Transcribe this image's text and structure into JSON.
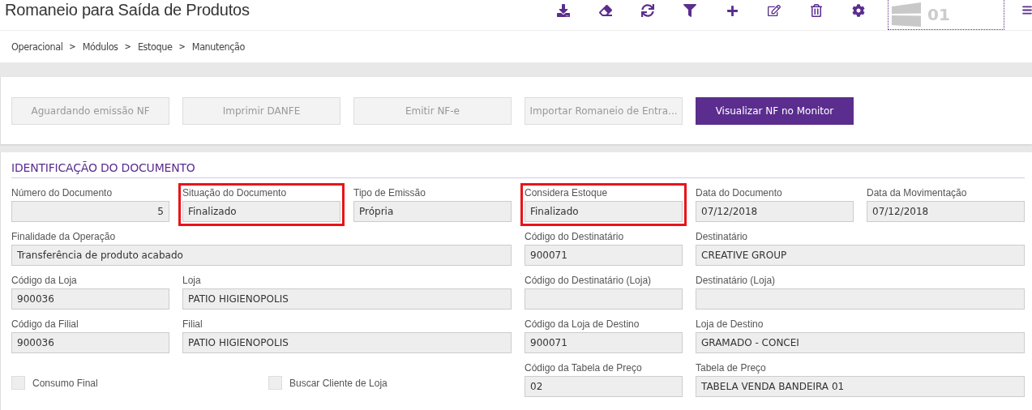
{
  "header": {
    "title": "Romaneio para Saída de Produtos",
    "logo_text": "01"
  },
  "breadcrumb": {
    "separator": ">",
    "items": [
      "Operacional",
      "Módulos",
      "Estoque",
      "Manutenção"
    ]
  },
  "actions": [
    {
      "label": "Aguardando emissão NF",
      "disabled": true
    },
    {
      "label": "Imprimir DANFE",
      "disabled": true
    },
    {
      "label": "Emitir NF-e",
      "disabled": true
    },
    {
      "label": "Importar Romaneio de Entra...",
      "disabled": true
    },
    {
      "label": "Visualizar NF no Monitor",
      "disabled": false
    }
  ],
  "section": {
    "title": "IDENTIFICAÇÃO DO DOCUMENTO",
    "rows": [
      [
        {
          "kind": "field",
          "label": "Número do Documento",
          "value": "5",
          "align_right": true,
          "highlighted": false
        },
        {
          "kind": "field",
          "label": "Situação do Documento",
          "value": "Finalizado",
          "highlighted": true
        },
        {
          "kind": "field",
          "label": "Tipo de Emissão",
          "value": "Própria",
          "highlighted": false
        },
        {
          "kind": "field",
          "label": "Considera Estoque",
          "value": "Finalizado",
          "highlighted": true
        },
        {
          "kind": "field",
          "label": "Data do Documento",
          "value": "07/12/2018",
          "highlighted": false
        },
        {
          "kind": "field",
          "label": "Data da Movimentação",
          "value": "07/12/2018",
          "highlighted": false
        }
      ],
      [
        {
          "kind": "wide3",
          "label": "Finalidade da Operação",
          "value": "Transferência de produto acabado",
          "highlighted": false
        },
        {
          "kind": "field",
          "label": "Código do Destinatário",
          "value": "900071",
          "highlighted": false
        },
        {
          "kind": "wide2",
          "label": "Destinatário",
          "value": "CREATIVE GROUP",
          "highlighted": false
        }
      ],
      [
        {
          "kind": "field",
          "label": "Código da Loja",
          "value": "900036",
          "highlighted": false
        },
        {
          "kind": "wide2",
          "label": "Loja",
          "value": "PATIO HIGIENOPOLIS",
          "highlighted": false
        },
        {
          "kind": "field",
          "label": "Código do Destinatário (Loja)",
          "highlighted": false
        },
        {
          "kind": "wide2",
          "label": "Destinatário (Loja)",
          "highlighted": false
        }
      ],
      [
        {
          "kind": "field",
          "label": "Código da Filial",
          "value": "900036",
          "highlighted": false
        },
        {
          "kind": "wide2",
          "label": "Filial",
          "value": "PATIO HIGIENOPOLIS",
          "highlighted": false
        },
        {
          "kind": "field",
          "label": "Código da Loja de Destino",
          "value": "900071",
          "highlighted": false
        },
        {
          "kind": "wide2",
          "label": "Loja de Destino",
          "value": "GRAMADO - CONCEI",
          "highlighted": false
        }
      ],
      [
        {
          "kind": "checkboxes",
          "items": [
            {
              "label": "Consumo Final",
              "checked": false
            },
            {
              "label": "Buscar Cliente de Loja",
              "checked": false
            }
          ]
        },
        {
          "kind": "field",
          "label": "Código da Tabela de Preço",
          "value": "02",
          "highlighted": false
        },
        {
          "kind": "wide2",
          "label": "Tabela de Preço",
          "value": "TABELA VENDA BANDEIRA 01",
          "highlighted": false
        }
      ]
    ]
  }
}
